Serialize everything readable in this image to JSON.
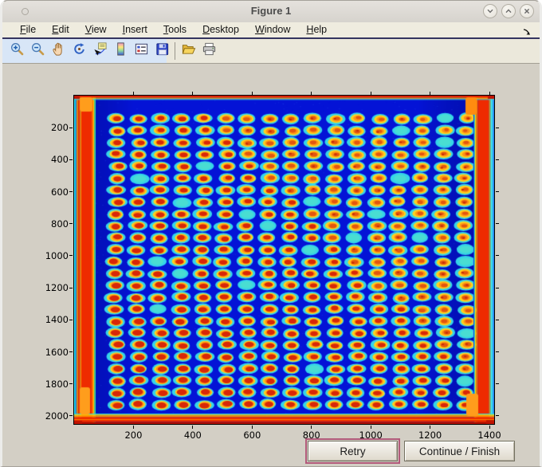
{
  "window": {
    "title": "Figure 1",
    "controls": [
      {
        "name": "minimize",
        "icon": "chevron-down-icon"
      },
      {
        "name": "maximize",
        "icon": "chevron-up-icon"
      },
      {
        "name": "close",
        "icon": "close-icon"
      }
    ]
  },
  "menu": {
    "items": [
      "File",
      "Edit",
      "View",
      "Insert",
      "Tools",
      "Desktop",
      "Window",
      "Help"
    ],
    "dock_icon": "dock-figure-arrow-icon"
  },
  "toolbar": {
    "buttons": [
      "zoom-in",
      "zoom-out",
      "pan",
      "rotate-3d",
      "data-cursor",
      "colorbar",
      "insert-legend",
      "save-figure",
      "separator",
      "open-file",
      "print-figure"
    ]
  },
  "dialog_buttons": {
    "retry": "Retry",
    "continue_finish": "Continue / Finish",
    "retry_focus_ring_color": "#b25a7a"
  },
  "chart_data": {
    "type": "heatmap",
    "title": "",
    "xlabel": "",
    "ylabel": "",
    "description": "Fluorescence scan of a spotted microarray/plate shown with jet colormap: regular grid of circular spots (red-orange centers, yellow rings, cyan halos) on a deep blue background, with saturated red-orange bands along all four plate edges and small orange tabs at the corners. Spot centers are reddest toward the lower-left and yellower toward the upper-right.",
    "colormap": "jet",
    "x_ticks": [
      200,
      400,
      600,
      800,
      1000,
      1200,
      1400
    ],
    "y_ticks": [
      200,
      400,
      600,
      800,
      1000,
      1200,
      1400,
      1600,
      1800,
      2000
    ],
    "x_range": [
      1,
      1416
    ],
    "y_range": [
      1,
      2050
    ],
    "y_direction": "down",
    "grid": {
      "rows": 25,
      "cols": 17,
      "first_spot_x": 140,
      "first_spot_y": 144,
      "x_spacing": 74,
      "y_spacing": 74,
      "spot_diameter_units": 57
    },
    "colors": {
      "background": "#0413d6",
      "spot_halo": "#38dfeb",
      "spot_ring": "#ffd21e",
      "spot_center": "#d82707",
      "edge_band": "#ee2b00",
      "edge_accent": "#ff9900",
      "corner_tab": "#ff9d1c"
    }
  }
}
